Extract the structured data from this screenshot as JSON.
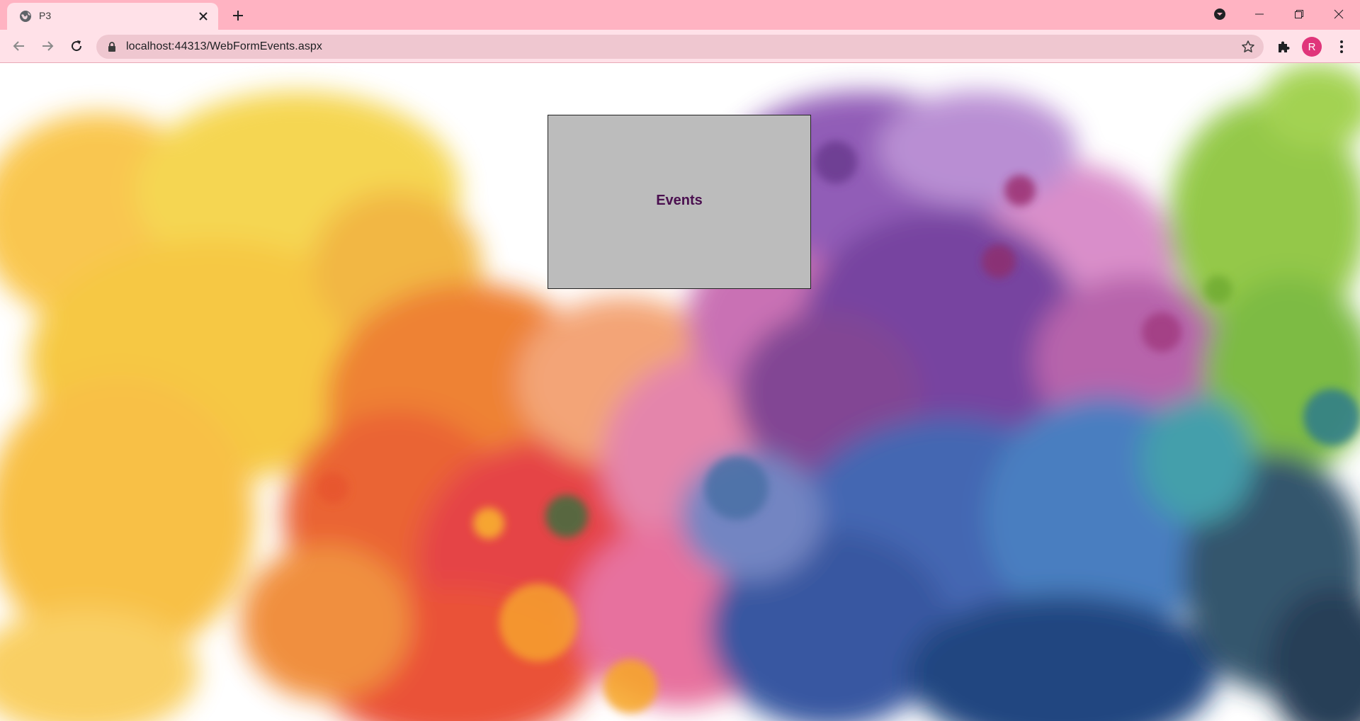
{
  "browser": {
    "tab_title": "P3",
    "url": "localhost:44313/WebFormEvents.aspx",
    "profile_initial": "R",
    "colors": {
      "tabstrip": "#ffb3c2",
      "toolbar": "#ffe1e8",
      "omnibox": "#efc7d0",
      "profile": "#e0357a"
    },
    "icons": [
      "globe-icon",
      "close-icon",
      "plus-icon",
      "tab-search-icon",
      "minimize-icon",
      "restore-icon",
      "window-close-icon",
      "back-icon",
      "forward-icon",
      "reload-icon",
      "lock-icon",
      "star-icon",
      "puzzle-icon",
      "kebab-menu-icon"
    ]
  },
  "page": {
    "panel_label": "Events",
    "panel_background": "#bcbcbc",
    "panel_text_color": "#4a0f4f",
    "background": "watercolor paint splash"
  }
}
